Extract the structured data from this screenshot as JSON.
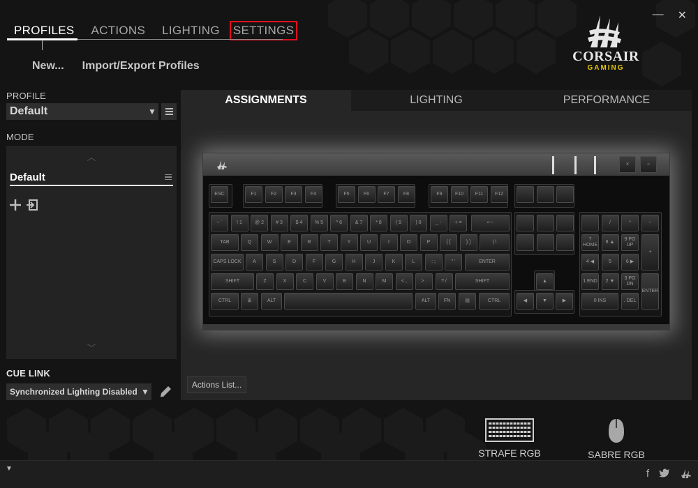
{
  "window": {
    "minimize": "—",
    "close": "✕"
  },
  "nav": {
    "tabs": [
      {
        "label": "PROFILES",
        "active": true
      },
      {
        "label": "ACTIONS"
      },
      {
        "label": "LIGHTING"
      },
      {
        "label": "SETTINGS",
        "highlighted": true
      }
    ],
    "sub": {
      "new_label": "New...",
      "import_export_label": "Import/Export Profiles"
    }
  },
  "logo": {
    "brand": "CORSAIR",
    "sub": "GAMING",
    "sub_color": "#e5c600"
  },
  "profile": {
    "label": "PROFILE",
    "value": "Default"
  },
  "mode": {
    "label": "MODE",
    "items": [
      {
        "name": "Default",
        "selected": true
      }
    ]
  },
  "cue_link": {
    "label": "CUE LINK",
    "value": "Synchronized Lighting Disabled"
  },
  "main": {
    "tabs": [
      {
        "label": "ASSIGNMENTS",
        "active": true
      },
      {
        "label": "LIGHTING"
      },
      {
        "label": "PERFORMANCE"
      }
    ],
    "actions_list_label": "Actions List..."
  },
  "keyboard": {
    "row_fn": [
      "ESC",
      "F1",
      "F2",
      "F3",
      "F4",
      "F5",
      "F6",
      "F7",
      "F8",
      "F9",
      "F10",
      "F11",
      "F12"
    ],
    "row_num": [
      "~ `",
      "! 1",
      "@ 2",
      "# 3",
      "$ 4",
      "% 5",
      "^ 6",
      "& 7",
      "* 8",
      "( 9",
      ") 0",
      "_ -",
      "+ ="
    ],
    "row_q": [
      "TAB",
      "Q",
      "W",
      "E",
      "R",
      "T",
      "Y",
      "U",
      "I",
      "O",
      "P",
      "{ [",
      "} ]",
      "| \\"
    ],
    "row_a": [
      "CAPS LOCK",
      "A",
      "S",
      "D",
      "F",
      "G",
      "H",
      "J",
      "K",
      "L",
      ": ;",
      "\" '",
      "ENTER"
    ],
    "row_z": [
      "SHIFT",
      "Z",
      "X",
      "C",
      "V",
      "B",
      "N",
      "M",
      "< ,",
      "> .",
      "? /",
      "SHIFT"
    ],
    "row_ctrl": [
      "CTRL",
      "⊞",
      "ALT",
      "ALT",
      "FN",
      "▤",
      "CTRL"
    ],
    "arrows": [
      "▲",
      "◀",
      "▼",
      "▶"
    ],
    "numpad_top": [
      "NUM LOCK",
      "/",
      "*",
      "−"
    ],
    "numpad": [
      "7 HOME",
      "8 ▲",
      "9 PG UP",
      "4 ◀",
      "5",
      "6 ▶",
      "1 END",
      "2 ▼",
      "3 PG DN",
      "0 INS",
      ". DEL"
    ],
    "numpad_side": [
      "+",
      "ENTER"
    ],
    "nav_cluster": [
      "INSERT",
      "HOME",
      "PAGE UP",
      "DELETE",
      "END",
      "PAGE DOWN"
    ]
  },
  "devices": [
    {
      "name": "STRAFE RGB"
    },
    {
      "name": "SABRE RGB"
    }
  ],
  "footer": {
    "expand": "▼"
  }
}
